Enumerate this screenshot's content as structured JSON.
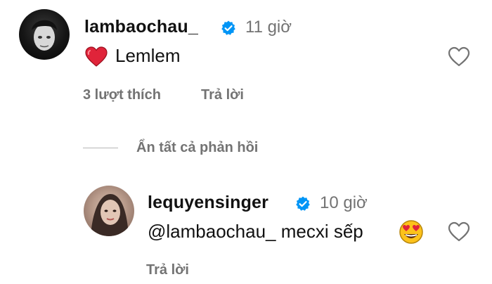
{
  "comment": {
    "username": "lambaochau_",
    "time": "11 giờ",
    "text": "Lemlem",
    "likes": "3 lượt thích",
    "reply_label": "Trả lời",
    "verified": true
  },
  "toggle_replies_label": "Ẩn tất cả phản hồi",
  "reply": {
    "username": "lequyensinger",
    "time": "10 giờ",
    "text": "@lambaochau_ mecxi sếp",
    "reply_label": "Trả lời",
    "verified": true
  },
  "colors": {
    "verified_blue": "#0095f6",
    "heart_red": "#ed4956",
    "muted_text": "#737373"
  },
  "icons": {
    "verified": "verified-badge-icon",
    "heart": "heart-icon",
    "like": "heart-outline-icon",
    "emoji": "heart-eyes-emoji-icon"
  }
}
